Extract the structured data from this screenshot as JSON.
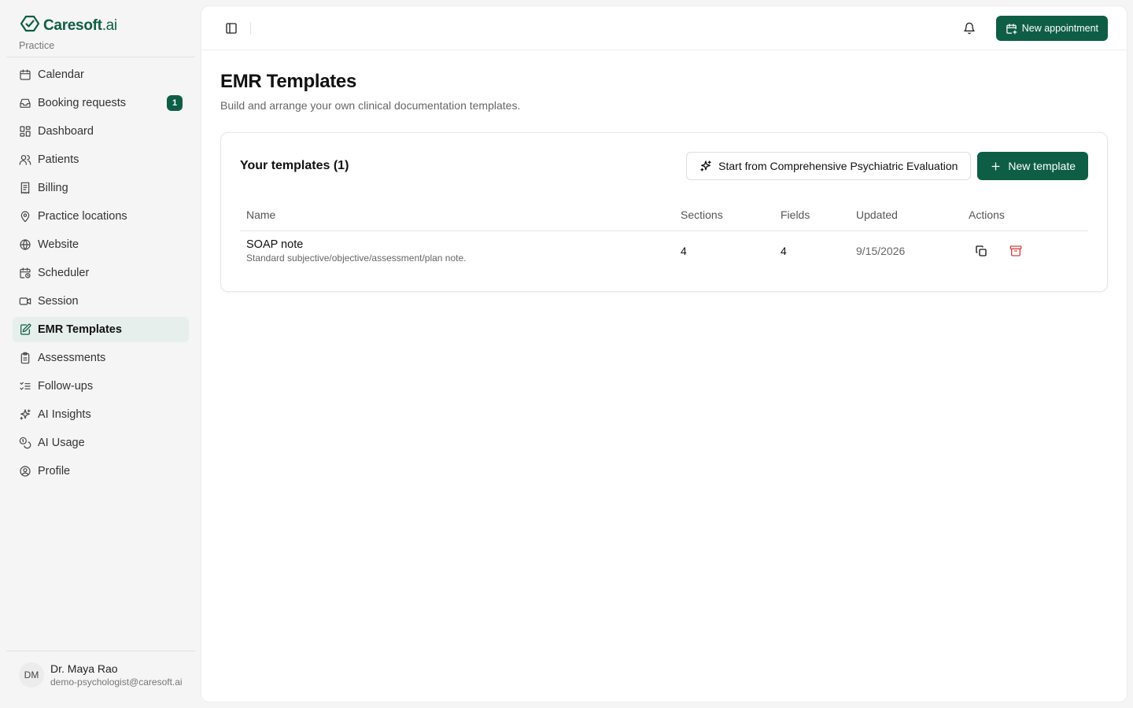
{
  "brand": {
    "name": "Caresoft",
    "suffix": ".ai",
    "sub": "Practice",
    "color": "#0e5e45"
  },
  "nav": [
    {
      "label": "Calendar",
      "icon": "calendar-icon"
    },
    {
      "label": "Booking requests",
      "icon": "inbox-icon",
      "badge": "1"
    },
    {
      "label": "Dashboard",
      "icon": "dashboard-icon"
    },
    {
      "label": "Patients",
      "icon": "users-icon"
    },
    {
      "label": "Billing",
      "icon": "receipt-icon"
    },
    {
      "label": "Practice locations",
      "icon": "map-pin-icon"
    },
    {
      "label": "Website",
      "icon": "globe-icon"
    },
    {
      "label": "Scheduler",
      "icon": "calendar-clock-icon"
    },
    {
      "label": "Session",
      "icon": "video-icon"
    },
    {
      "label": "EMR Templates",
      "icon": "file-edit-icon",
      "active": true
    },
    {
      "label": "Assessments",
      "icon": "clipboard-icon"
    },
    {
      "label": "Follow-ups",
      "icon": "list-checks-icon"
    },
    {
      "label": "AI Insights",
      "icon": "sparkles-icon"
    },
    {
      "label": "AI Usage",
      "icon": "coins-icon"
    },
    {
      "label": "Profile",
      "icon": "user-circle-icon"
    }
  ],
  "user": {
    "initials": "DM",
    "name": "Dr. Maya Rao",
    "email": "demo-psychologist@caresoft.ai"
  },
  "topbar": {
    "new_appointment": "New appointment"
  },
  "page": {
    "title": "EMR Templates",
    "description": "Build and arrange your own clinical documentation templates."
  },
  "templates_card": {
    "title": "Your templates (1)",
    "start_from_label": "Start from Comprehensive Psychiatric Evaluation",
    "new_template_label": "New template",
    "columns": [
      "Name",
      "Sections",
      "Fields",
      "Updated",
      "Actions"
    ],
    "rows": [
      {
        "name": "SOAP note",
        "description": "Standard subjective/objective/assessment/plan note.",
        "sections": "4",
        "fields": "4",
        "updated": "9/15/2026"
      }
    ]
  },
  "colors": {
    "accent": "#0e5e45",
    "active_bg": "#e6efeb",
    "danger": "#dc3f3f"
  }
}
